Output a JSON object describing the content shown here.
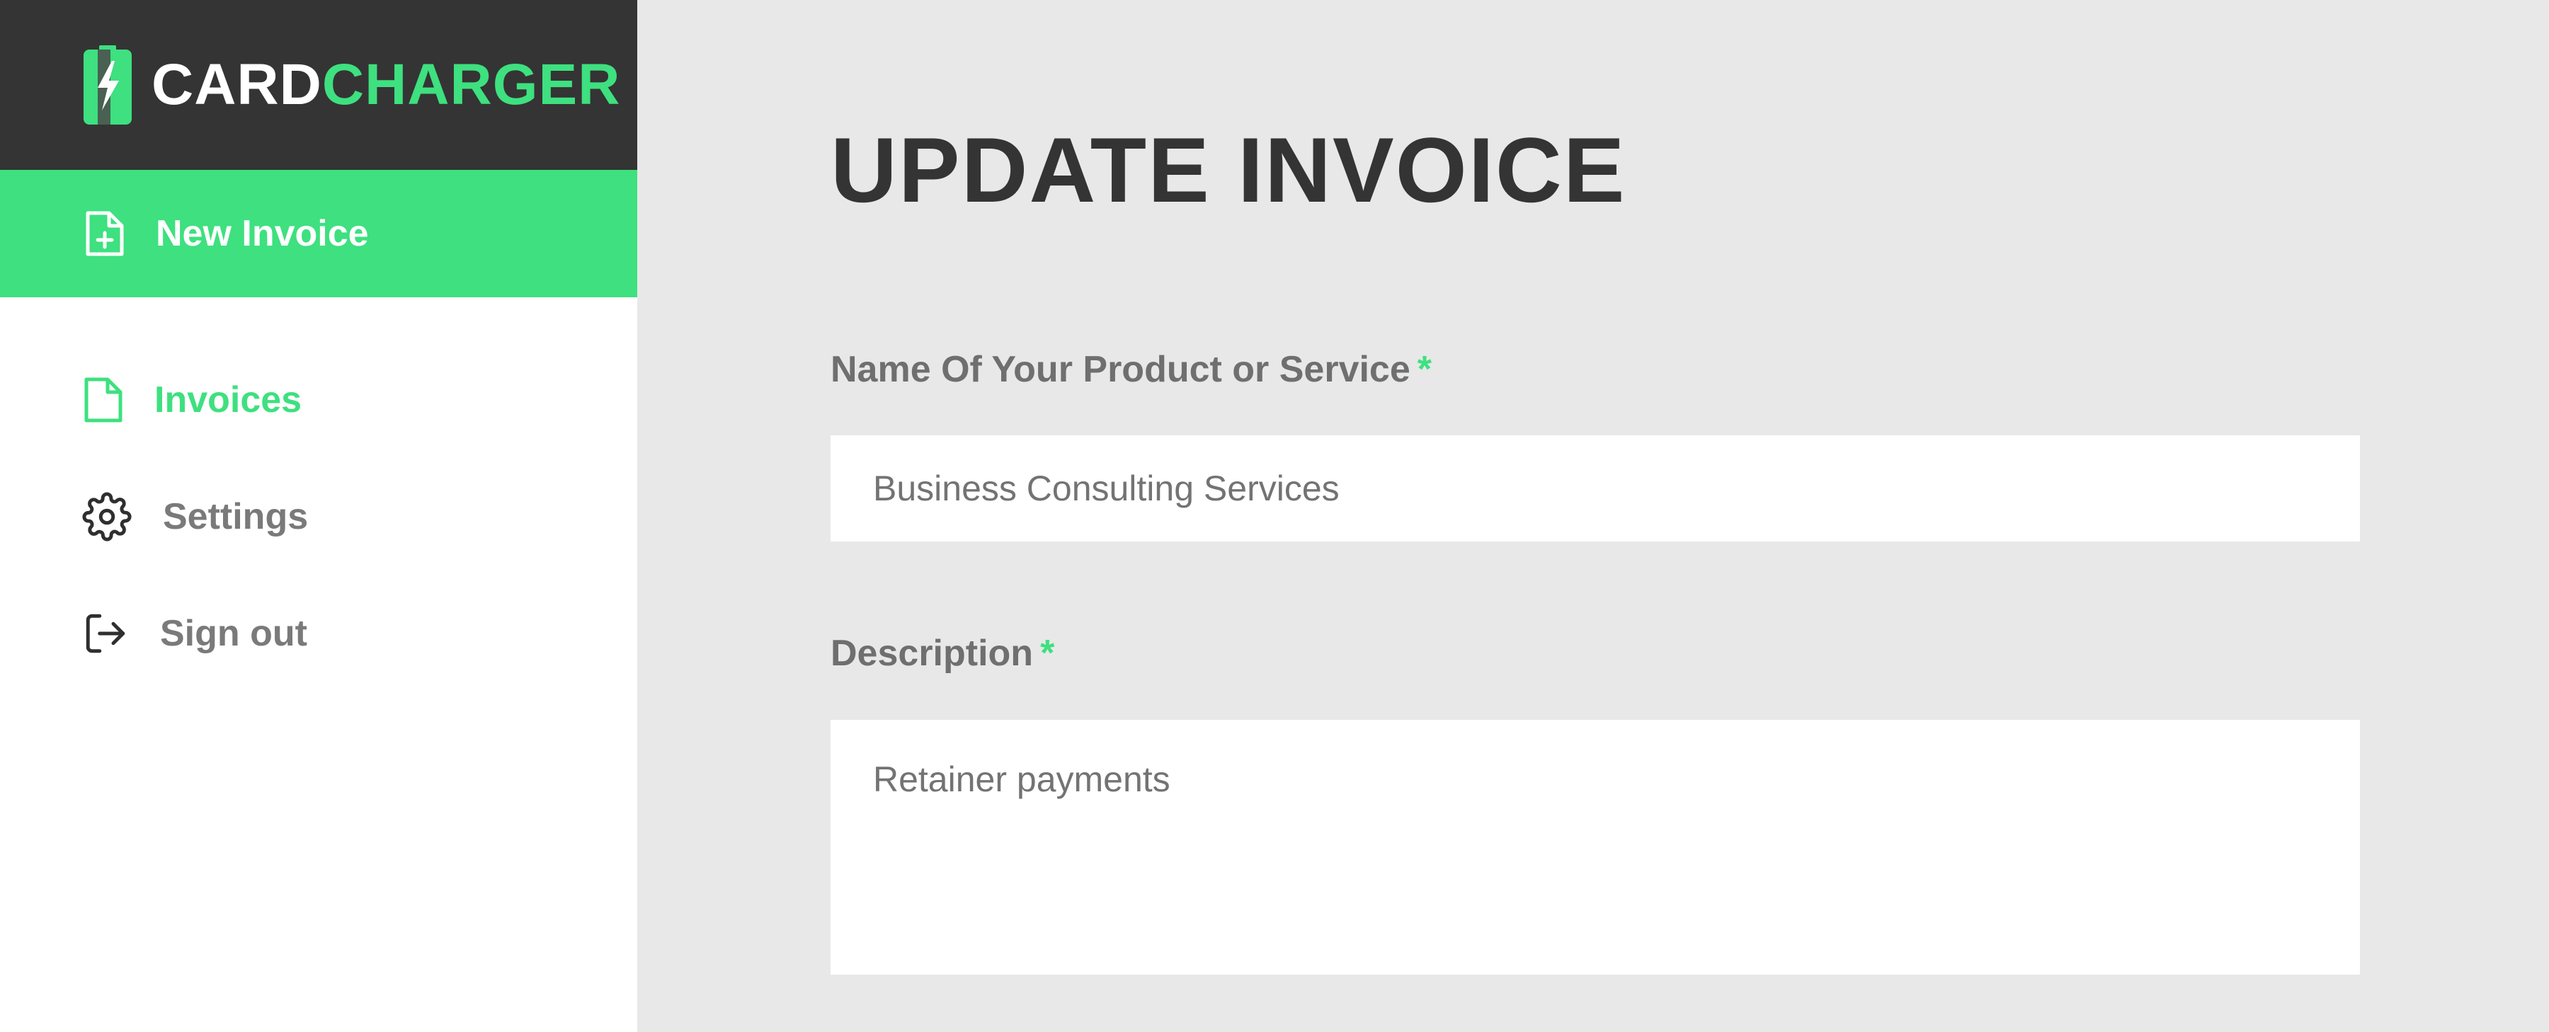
{
  "brand": {
    "part1": "CARD",
    "part2": "CHARGER"
  },
  "sidebar": {
    "cta": {
      "label": "New Invoice",
      "icon": "file-plus-icon"
    },
    "items": [
      {
        "label": "Invoices",
        "icon": "file-icon",
        "active": true
      },
      {
        "label": "Settings",
        "icon": "gear-icon",
        "active": false
      },
      {
        "label": "Sign out",
        "icon": "sign-out-icon",
        "active": false
      }
    ]
  },
  "main": {
    "title": "UPDATE INVOICE",
    "fields": [
      {
        "label": "Name Of Your Product or Service",
        "required_mark": "*",
        "value": "Business Consulting Services"
      },
      {
        "label": "Description",
        "required_mark": "*",
        "value": "Retainer payments"
      }
    ]
  },
  "colors": {
    "accent": "#3ee07f",
    "dark": "#343434",
    "muted": "#7a7a7a",
    "background": "#e8e8e8"
  }
}
